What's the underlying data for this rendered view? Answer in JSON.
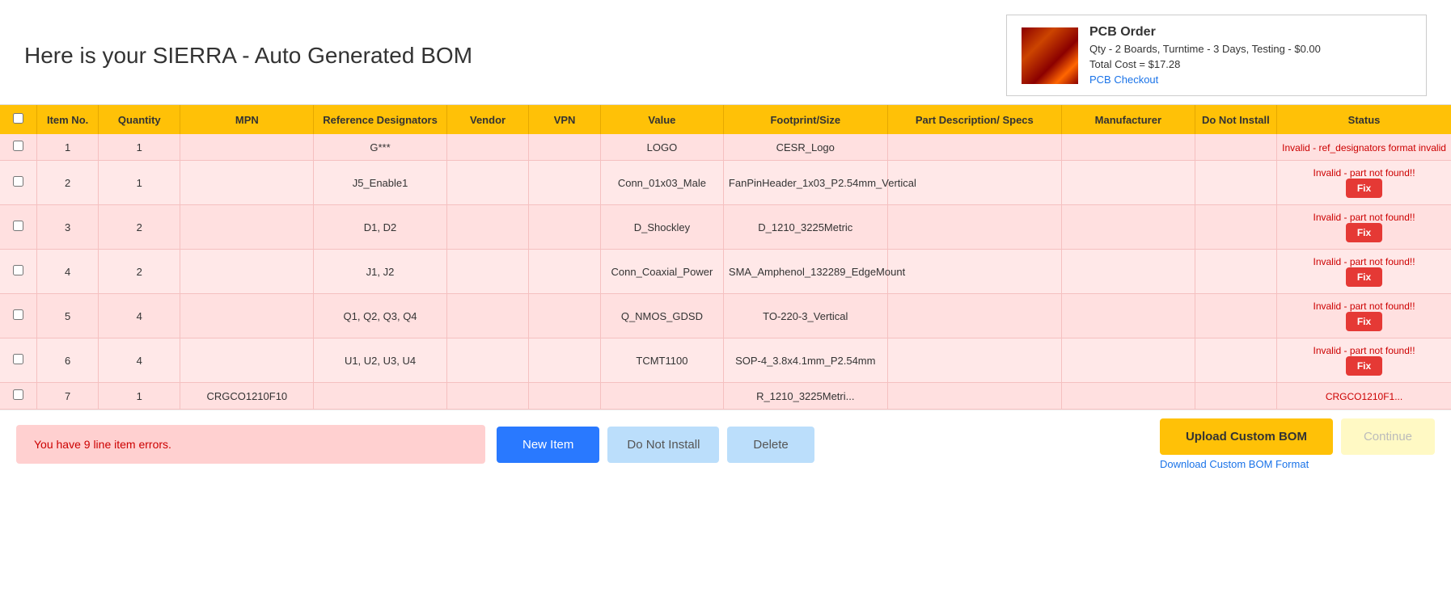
{
  "header": {
    "title": "Here is your SIERRA - Auto Generated BOM",
    "pcb_order": {
      "label": "PCB Order",
      "details": "Qty - 2 Boards, Turntime - 3 Days, Testing - $0.00",
      "total_cost": "Total Cost = $17.28",
      "checkout_link": "PCB Checkout"
    }
  },
  "table": {
    "columns": [
      "",
      "Item No.",
      "Quantity",
      "MPN",
      "Reference Designators",
      "Vendor",
      "VPN",
      "Value",
      "Footprint/Size",
      "Part Description/ Specs",
      "Manufacturer",
      "Do Not Install",
      "Status"
    ],
    "rows": [
      {
        "checked": false,
        "item_no": "1",
        "quantity": "1",
        "mpn": "",
        "ref_des": "G***",
        "vendor": "",
        "vpn": "",
        "value": "LOGO",
        "footprint": "CESR_Logo",
        "part_desc": "",
        "manufacturer": "",
        "dni": "",
        "status_text": "Invalid - ref_designators format invalid",
        "has_fix": false
      },
      {
        "checked": false,
        "item_no": "2",
        "quantity": "1",
        "mpn": "",
        "ref_des": "J5_Enable1",
        "vendor": "",
        "vpn": "",
        "value": "Conn_01x03_Male",
        "footprint": "FanPinHeader_1x03_P2.54mm_Vertical",
        "part_desc": "",
        "manufacturer": "",
        "dni": "",
        "status_text": "Invalid - part not found!!",
        "has_fix": true
      },
      {
        "checked": false,
        "item_no": "3",
        "quantity": "2",
        "mpn": "",
        "ref_des": "D1, D2",
        "vendor": "",
        "vpn": "",
        "value": "D_Shockley",
        "footprint": "D_1210_3225Metric",
        "part_desc": "",
        "manufacturer": "",
        "dni": "",
        "status_text": "Invalid - part not found!!",
        "has_fix": true
      },
      {
        "checked": false,
        "item_no": "4",
        "quantity": "2",
        "mpn": "",
        "ref_des": "J1, J2",
        "vendor": "",
        "vpn": "",
        "value": "Conn_Coaxial_Power",
        "footprint": "SMA_Amphenol_132289_EdgeMount",
        "part_desc": "",
        "manufacturer": "",
        "dni": "",
        "status_text": "Invalid - part not found!!",
        "has_fix": true
      },
      {
        "checked": false,
        "item_no": "5",
        "quantity": "4",
        "mpn": "",
        "ref_des": "Q1, Q2, Q3, Q4",
        "vendor": "",
        "vpn": "",
        "value": "Q_NMOS_GDSD",
        "footprint": "TO-220-3_Vertical",
        "part_desc": "",
        "manufacturer": "",
        "dni": "",
        "status_text": "Invalid - part not found!!",
        "has_fix": true
      },
      {
        "checked": false,
        "item_no": "6",
        "quantity": "4",
        "mpn": "",
        "ref_des": "U1, U2, U3, U4",
        "vendor": "",
        "vpn": "",
        "value": "TCMT1100",
        "footprint": "SOP-4_3.8x4.1mm_P2.54mm",
        "part_desc": "",
        "manufacturer": "",
        "dni": "",
        "status_text": "Invalid - part not found!!",
        "has_fix": true
      },
      {
        "checked": false,
        "item_no": "7",
        "quantity": "1",
        "mpn": "CRGCO1210F10",
        "ref_des": "",
        "vendor": "",
        "vpn": "",
        "value": "",
        "footprint": "R_1210_3225Metri...",
        "part_desc": "",
        "manufacturer": "",
        "dni": "",
        "status_text": "CRGCO1210F1...",
        "has_fix": false
      }
    ]
  },
  "footer": {
    "error_message": "You have 9 line item errors.",
    "buttons": {
      "new_item": "New Item",
      "do_not_install": "Do Not Install",
      "delete": "Delete",
      "upload_bom": "Upload Custom BOM",
      "continue": "Continue"
    },
    "download_link": "Download Custom BOM Format"
  }
}
